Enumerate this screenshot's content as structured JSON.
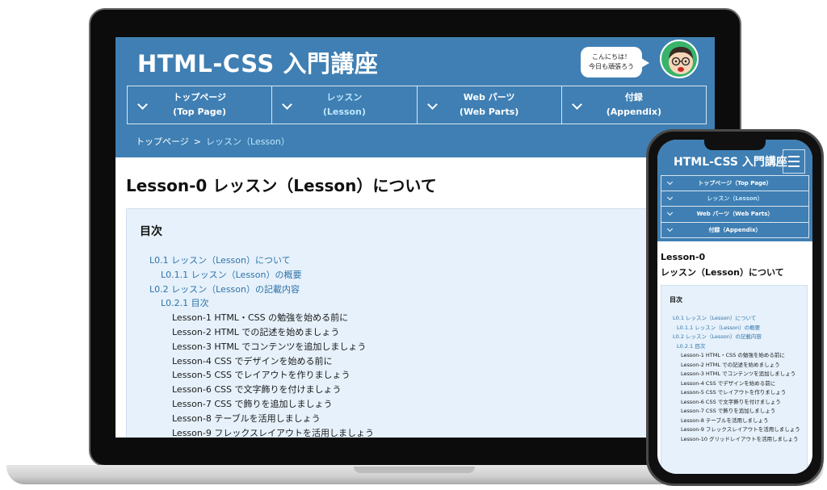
{
  "site": {
    "title": "HTML-CSS 入門講座",
    "greeting_line1": "こんにちは！",
    "greeting_line2": "今日も頑張ろう"
  },
  "nav": [
    {
      "label": "トップページ",
      "sub": "(Top Page)"
    },
    {
      "label": "レッスン",
      "sub": "(Lesson)"
    },
    {
      "label": "Web パーツ",
      "sub": "(Web Parts)"
    },
    {
      "label": "付録",
      "sub": "(Appendix)"
    }
  ],
  "breadcrumb": {
    "home": "トップページ",
    "separator": ">",
    "current": "レッスン（Lesson）"
  },
  "page": {
    "heading": "Lesson-0 レッスン（Lesson）について"
  },
  "toc": {
    "title": "目次",
    "items": [
      "L0.1 レッスン（Lesson）について",
      "L0.1.1 レッスン（Lesson）の概要",
      "L0.2 レッスン（Lesson）の記載内容",
      "L0.2.1 目次",
      "Lesson-1 HTML・CSS の勉強を始める前に",
      "Lesson-2 HTML での記述を始めましょう",
      "Lesson-3 HTML でコンテンツを追加しましょう",
      "Lesson-4 CSS でデザインを始める前に",
      "Lesson-5 CSS でレイアウトを作りましょう",
      "Lesson-6 CSS で文字飾りを付けましょう",
      "Lesson-7 CSS で飾りを追加しましょう",
      "Lesson-8 テーブルを活用しましょう",
      "Lesson-9 フレックスレイアウトを活用しましょう"
    ]
  },
  "mobile": {
    "title": "HTML-CSS 入門講座",
    "nav": [
      "トップページ（Top Page）",
      "レッスン（Lesson）",
      "Web パーツ（Web Parts）",
      "付録（Appendix）"
    ],
    "heading_line1": "Lesson-0",
    "heading_line2": "レッスン（Lesson）について",
    "toc_title": "目次",
    "toc_items": [
      "L0.1 レッスン（Lesson）について",
      "L0.1.1 レッスン（Lesson）の概要",
      "L0.2 レッスン（Lesson）の記載内容",
      "L0.2.1 目次",
      "Lesson-1 HTML・CSS の勉強を始める前に",
      "Lesson-2 HTML での記述を始めましょう",
      "Lesson-3 HTML でコンテンツを追加しましょう",
      "Lesson-4 CSS でデザインを始める前に",
      "Lesson-5 CSS でレイアウトを作りましょう",
      "Lesson-6 CSS で文字飾りを付けましょう",
      "Lesson-7 CSS で飾りを追加しましょう",
      "Lesson-8 テーブルを活用しましょう",
      "Lesson-9 フレックスレイアウトを活用しましょう",
      "Lesson-10 グリッドレイアウトを活用しましょう"
    ]
  },
  "colors": {
    "header_blue": "#3f7fb3",
    "toc_bg": "#e6f1fb",
    "link_blue": "#2f73a8",
    "active_nav": "#bfe7ff",
    "avatar_green": "#37b36b"
  },
  "icons": {
    "avatar": "teacher-avatar-icon",
    "nav_chevron": "chevron-down-icon",
    "menu": "hamburger-menu-icon"
  }
}
